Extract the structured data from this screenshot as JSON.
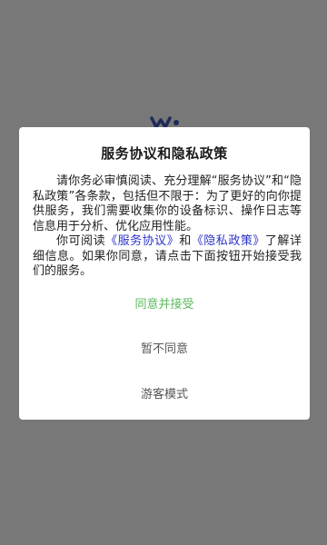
{
  "dialog": {
    "title": "服务协议和隐私政策",
    "para1": "请你务必审慎阅读、充分理解“服务协议”和“隐私政策”各条款，包括但不限于：为了更好的向你提供服务，我们需要收集你的设备标识、操作日志等信息用于分析、优化应用性能。",
    "para2_prefix": "你可阅读",
    "service_link": "《服务协议》",
    "para2_and": "和",
    "privacy_link": "《隐私政策》",
    "para2_suffix": "了解详细信息。如果你同意，请点击下面按钮开始接受我们的服务。",
    "agree_label": "同意并接受",
    "disagree_label": "暂不同意",
    "guest_label": "游客模式"
  },
  "colors": {
    "backdrop": "#787878",
    "agree": "#5cb85c",
    "link": "#2b33c8",
    "logo": "#1e2a5a"
  },
  "icons": {
    "app_logo": "app-logo-icon"
  }
}
